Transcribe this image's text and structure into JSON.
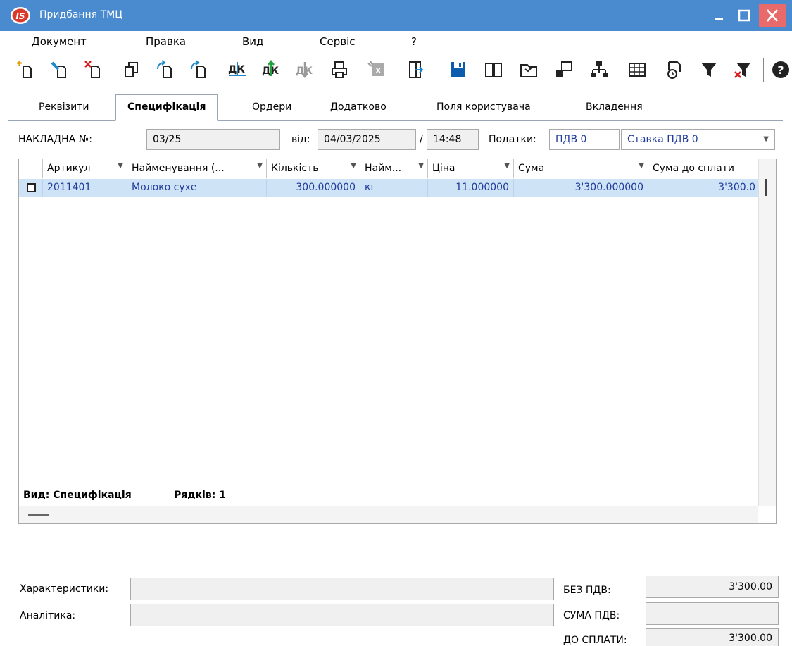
{
  "window": {
    "title": "Придбання ТМЦ"
  },
  "menu": [
    "Документ",
    "Правка",
    "Вид",
    "Сервіс",
    "?"
  ],
  "tabs": [
    "Реквізити",
    "Специфікація",
    "Ордери",
    "Додатково",
    "Поля користувача",
    "Вкладення"
  ],
  "header": {
    "invoice_label": "НАКЛАДНА №:",
    "invoice_number": "03/25",
    "from_label": "від:",
    "date": "04/03/2025",
    "slash": "/",
    "time": "14:48",
    "taxes_label": "Податки:",
    "tax": "ПДВ  0",
    "vat_rate": "Ставка ПДВ 0"
  },
  "table": {
    "columns": [
      "Артикул",
      "Найменування (...",
      "Кількість",
      "Найм...",
      "Ціна",
      "Сума",
      "Сума до сплати"
    ],
    "rows": [
      [
        "2011401",
        "Молоко сухе",
        "300.000000",
        "кг",
        "11.000000",
        "3'300.000000",
        "3'300.0"
      ]
    ],
    "footer_view": "Вид: Специфікація",
    "footer_rows": "Рядків: 1"
  },
  "bottom": {
    "characteristics_label": "Характеристики:",
    "analytics_label": "Аналітика:",
    "no_vat_label": "БЕЗ ПДВ:",
    "no_vat_value": "3'300.00",
    "vat_sum_label": "СУМА ПДВ:",
    "vat_sum_value": "",
    "to_pay_label": "ДО СПЛАТИ:",
    "to_pay_value": "3'300.00"
  },
  "colors": {
    "titlebar": "#4a8bd0",
    "close": "#e86a6a",
    "row_selected": "#cfe3f7",
    "link_text": "#1f3a9a"
  }
}
